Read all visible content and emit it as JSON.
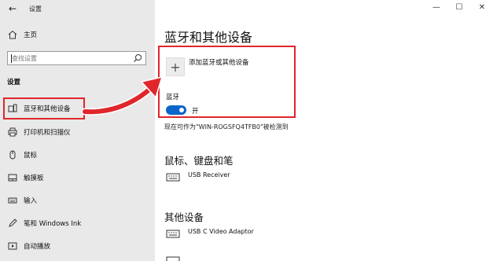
{
  "window": {
    "title": "设置"
  },
  "sidebar": {
    "home_label": "主页",
    "search_placeholder": "查找设置",
    "section_label": "设置",
    "items": [
      {
        "label": "蓝牙和其他设备",
        "icon": "bluetooth-devices-icon"
      },
      {
        "label": "打印机和扫描仪",
        "icon": "printer-icon"
      },
      {
        "label": "鼠标",
        "icon": "mouse-icon"
      },
      {
        "label": "触摸板",
        "icon": "touchpad-icon"
      },
      {
        "label": "输入",
        "icon": "keyboard-icon"
      },
      {
        "label": "笔和 Windows Ink",
        "icon": "pen-icon"
      },
      {
        "label": "自动播放",
        "icon": "autoplay-icon"
      }
    ]
  },
  "main": {
    "title": "蓝牙和其他设备",
    "add_device_label": "添加蓝牙或其他设备",
    "bluetooth_label": "蓝牙",
    "bluetooth_state": "开",
    "discoverable_text": "现在可作为\"WIN-ROGSFQ4TFB0\"被检测到",
    "groups": [
      {
        "title": "鼠标、键盘和笔",
        "devices": [
          "USB Receiver"
        ]
      },
      {
        "title": "其他设备",
        "devices": [
          "USB C Video Adaptor"
        ]
      }
    ]
  },
  "colors": {
    "highlight": "#e0262c",
    "toggle_on": "#0a66c8",
    "sidebar_bg": "#e9e9e9"
  }
}
